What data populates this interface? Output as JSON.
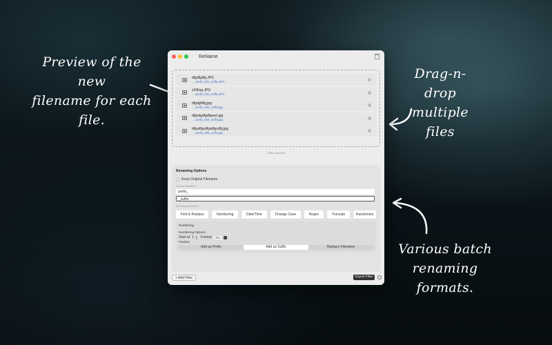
{
  "annotations": {
    "left": [
      "Preview of the new",
      "filename for each file."
    ],
    "right_top": [
      "Drag-n-drop",
      "multiple files"
    ],
    "right_bottom": [
      "Various batch",
      "renaming formats."
    ]
  },
  "window": {
    "title": "ReName"
  },
  "files": [
    {
      "name": "dfgdfgdfg.JPG",
      "new_name": "→ prefix_001_suffix.JPG"
    },
    {
      "name": "z345sg.JPG",
      "new_name": "→ prefix_002_suffix.JPG"
    },
    {
      "name": "dfgdgfdfg.jpg",
      "new_name": "→ prefix_003_suffix.jpg"
    },
    {
      "name": "dfgsdgdfgdfgsert.jpg",
      "new_name": "→ prefix_004_suffix.jpg"
    },
    {
      "name": "dfgsdfgsdfgsdfgsdfg.jpg",
      "new_name": "→ prefix_005_suffix.jpg"
    }
  ],
  "files_selected": "0 files selected",
  "options": {
    "title": "Renaming Options",
    "keep_original": "Keep Original Filename",
    "global_modifiers_label": "Global Modifiers",
    "prefix_value": "prefix_",
    "suffix_value": "_suffix",
    "renaming_method_label": "Renaming Method",
    "methods": [
      "Find & Replace",
      "Numbering",
      "Date/Time",
      "Change Case",
      "Regex",
      "Truncate",
      "Randomize"
    ],
    "numbering_label": "Numbering",
    "numbering_options_label": "Numbering Options",
    "start_at_label": "Start at",
    "start_at_value": "1",
    "format_label": "Format",
    "format_value": "001",
    "position_label": "Position",
    "positions": [
      "Add as Prefix",
      "Add as Suffix",
      "Replace Filename"
    ]
  },
  "bottom": {
    "add_files": "Add Files",
    "export_files": "Export Files"
  }
}
